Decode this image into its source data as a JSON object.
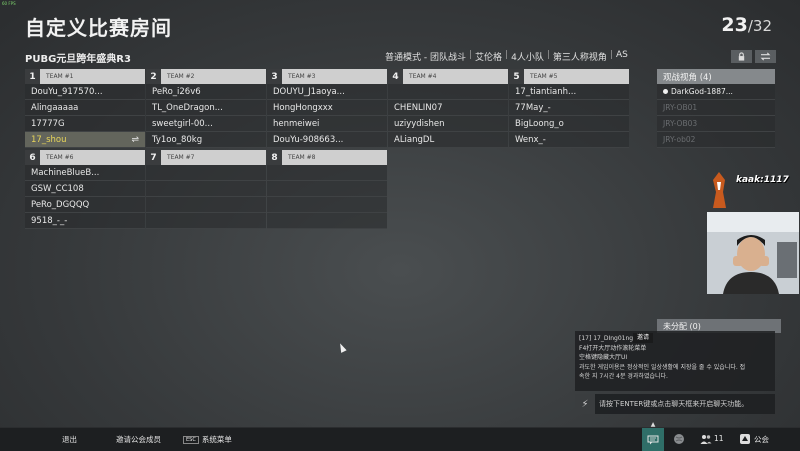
{
  "fps": "60 FPS",
  "title": "自定义比赛房间",
  "player_count": {
    "current": "23",
    "total": "/32"
  },
  "room_name": "PUBG元旦跨年盛典R3",
  "info": [
    "普通模式 - 团队战斗",
    "艾伦格",
    "4人小队",
    "第三人称视角",
    "AS"
  ],
  "top_icons": [
    "lock-icon",
    "swap-icon"
  ],
  "teams": [
    {
      "num": "1",
      "label": "TEAM #1",
      "players": [
        "DouYu_917570...",
        "Alingaaaaa",
        "17777G",
        "17_shou"
      ]
    },
    {
      "num": "2",
      "label": "TEAM #2",
      "players": [
        "PeRo_i26v6",
        "TL_OneDragon...",
        "sweetgirl-00...",
        "Ty1oo_80kg"
      ]
    },
    {
      "num": "3",
      "label": "TEAM #3",
      "players": [
        "DOUYU_J1aoya...",
        "HongHongxxx",
        "henmeiwei",
        "DouYu-908663..."
      ]
    },
    {
      "num": "4",
      "label": "TEAM #4",
      "players": [
        "",
        "CHENLIN07",
        "uziyydishen",
        "ALiangDL"
      ]
    },
    {
      "num": "5",
      "label": "TEAM #5",
      "players": [
        "17_tiantianh...",
        "77May_-",
        "BigLoong_o",
        "Wenx_-"
      ]
    },
    {
      "num": "6",
      "label": "TEAM #6",
      "players": [
        "MachineBlueB...",
        "GSW_CC108",
        "PeRo_DGQQQ",
        "9518_-_-"
      ]
    },
    {
      "num": "7",
      "label": "TEAM #7",
      "players": [
        "",
        "",
        "",
        ""
      ]
    },
    {
      "num": "8",
      "label": "TEAM #8",
      "players": [
        "",
        "",
        "",
        ""
      ]
    }
  ],
  "spectators": {
    "title": "观战视角 (4)",
    "items": [
      "DarkGod-1887...",
      "JRY-OB01",
      "JRY-OB03",
      "JRY-ob02"
    ]
  },
  "logo_text": "kaak:1117",
  "unassigned": "未分配 (0)",
  "chat": {
    "tag": "邀请",
    "lines": [
      "[17] 17_DIng01ng已上线",
      "F4打开大厅动作滚轮菜单",
      "空格键隐藏大厅UI",
      "과도한 게임이용은 정상적인 일상생활에 지장을 줄 수 있습니다. 접",
      "속한 지 7시간 4분 경과하였습니다."
    ],
    "placeholder": "请按下ENTER键或点击聊天框来开启聊天功能。"
  },
  "bottom": {
    "exit": "退出",
    "invite": "邀请公会成员",
    "esc": "ESC",
    "menu": "系统菜单",
    "friends": "11",
    "guild": "公会"
  },
  "colors": {
    "accent": "#e7d55a",
    "chat_active": "#2f6e68"
  }
}
